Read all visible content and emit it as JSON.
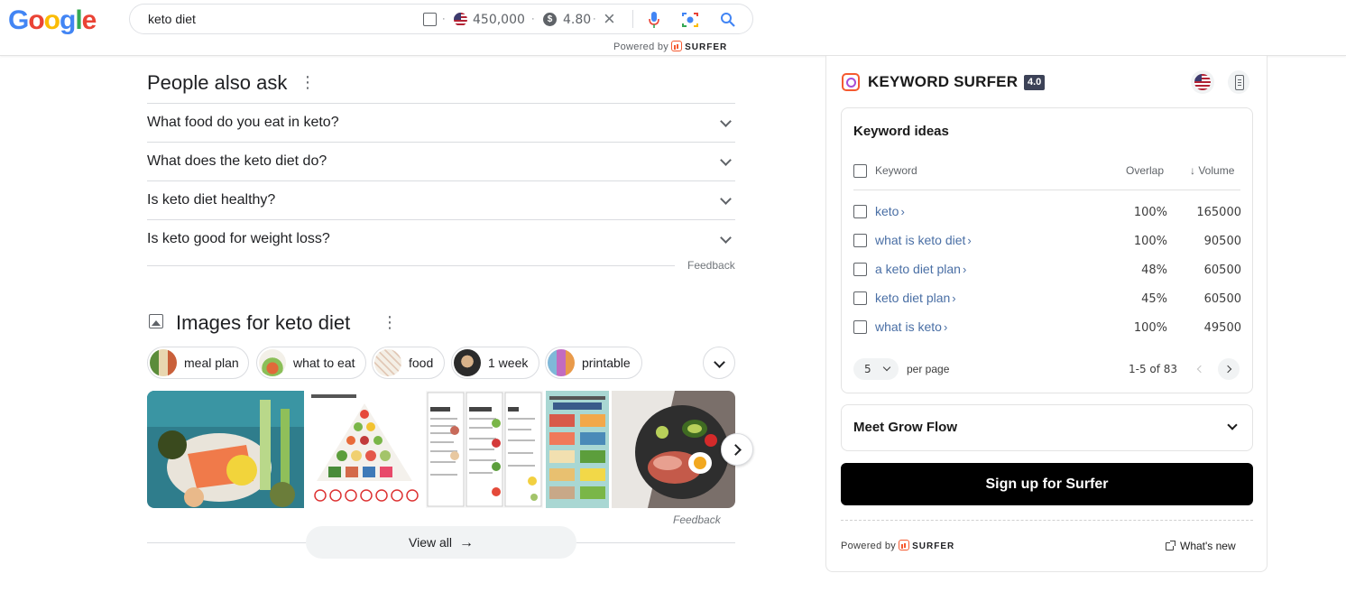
{
  "header": {
    "logo": "Google",
    "search_value": "keto diet",
    "search_volume": "450,000",
    "cpc_symbol": "$",
    "cpc": "4.80",
    "powered_by": "Powered by",
    "surfer_word": "SURFER"
  },
  "paa": {
    "title": "People also ask",
    "questions": [
      "What food do you eat in keto?",
      "What does the keto diet do?",
      "Is keto diet healthy?",
      "Is keto good for weight loss?"
    ],
    "feedback": "Feedback"
  },
  "images": {
    "title": "Images for keto diet",
    "chips": [
      "meal plan",
      "what to eat",
      "food",
      "1 week",
      "printable"
    ],
    "feedback": "Feedback",
    "view_all": "View all"
  },
  "keyword_surfer": {
    "title": "KEYWORD SURFER",
    "version": "4.0",
    "keyword_ideas_title": "Keyword ideas",
    "col_keyword": "Keyword",
    "col_overlap": "Overlap",
    "col_volume": "Volume",
    "rows": [
      {
        "keyword": "keto",
        "overlap": "100%",
        "volume": "165000"
      },
      {
        "keyword": "what is keto diet",
        "overlap": "100%",
        "volume": "90500"
      },
      {
        "keyword": "a keto diet plan",
        "overlap": "48%",
        "volume": "60500"
      },
      {
        "keyword": "keto diet plan",
        "overlap": "45%",
        "volume": "60500"
      },
      {
        "keyword": "what is keto",
        "overlap": "100%",
        "volume": "49500"
      }
    ],
    "per_page_value": "5",
    "per_page_label": "per page",
    "page_range": "1-5 of 83",
    "meet_grow_flow": "Meet Grow Flow",
    "signup": "Sign up for Surfer",
    "powered_by": "Powered by",
    "surfer_word": "SURFER",
    "whats_new": "What's new"
  },
  "colors": {
    "accent": "#f55a30",
    "link": "#4a6fa5",
    "signup_bg": "#000000"
  }
}
